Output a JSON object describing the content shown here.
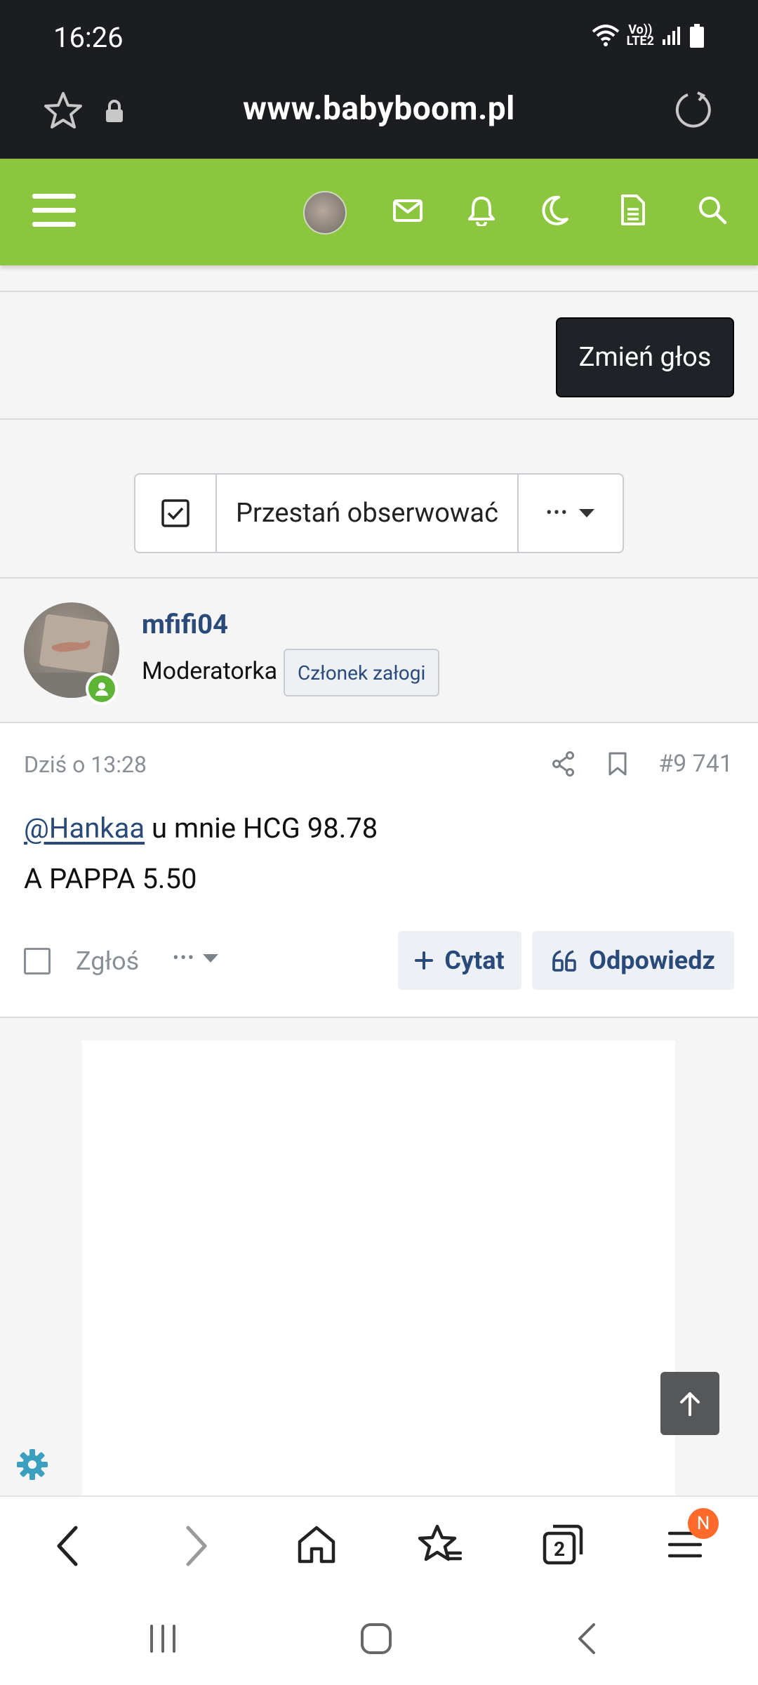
{
  "status_bar": {
    "time": "16:26",
    "network_label_top": "Vo))",
    "network_label_bottom": "LTE2"
  },
  "browser": {
    "url": "www.babyboom.pl",
    "tabs_count": "2",
    "menu_badge": "N"
  },
  "site_header": {
    "icons": [
      "menu-icon",
      "avatar",
      "mail-icon",
      "bell-icon",
      "moon-icon",
      "document-icon",
      "search-icon"
    ]
  },
  "poll": {
    "change_vote_label": "Zmień głos"
  },
  "follow": {
    "unfollow_label": "Przestań obserwować",
    "more_label": "•••"
  },
  "user": {
    "name": "mfifi04",
    "role": "Moderatorka",
    "badge": "Członek załogi"
  },
  "post": {
    "date": "Dziś o 13:28",
    "number": "#9 741",
    "mention": "@Hankaa",
    "line1_rest": " u mnie HCG 98.78",
    "line2": "A PAPPA 5.50",
    "report_label": "Zgłoś",
    "more_label": "•••",
    "quote_label": "Cytat",
    "reply_label": "Odpowiedz"
  },
  "colors": {
    "brand_green": "#8cc63f",
    "dark": "#1b1d20",
    "link_blue": "#2a4a7a",
    "badge_orange": "#ff6a2b"
  }
}
